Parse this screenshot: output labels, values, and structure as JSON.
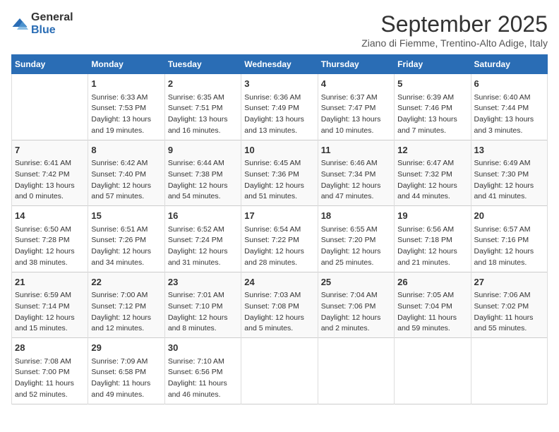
{
  "logo": {
    "general": "General",
    "blue": "Blue"
  },
  "title": "September 2025",
  "location": "Ziano di Fiemme, Trentino-Alto Adige, Italy",
  "days_of_week": [
    "Sunday",
    "Monday",
    "Tuesday",
    "Wednesday",
    "Thursday",
    "Friday",
    "Saturday"
  ],
  "weeks": [
    [
      {
        "day": "",
        "info": ""
      },
      {
        "day": "1",
        "info": "Sunrise: 6:33 AM\nSunset: 7:53 PM\nDaylight: 13 hours\nand 19 minutes."
      },
      {
        "day": "2",
        "info": "Sunrise: 6:35 AM\nSunset: 7:51 PM\nDaylight: 13 hours\nand 16 minutes."
      },
      {
        "day": "3",
        "info": "Sunrise: 6:36 AM\nSunset: 7:49 PM\nDaylight: 13 hours\nand 13 minutes."
      },
      {
        "day": "4",
        "info": "Sunrise: 6:37 AM\nSunset: 7:47 PM\nDaylight: 13 hours\nand 10 minutes."
      },
      {
        "day": "5",
        "info": "Sunrise: 6:39 AM\nSunset: 7:46 PM\nDaylight: 13 hours\nand 7 minutes."
      },
      {
        "day": "6",
        "info": "Sunrise: 6:40 AM\nSunset: 7:44 PM\nDaylight: 13 hours\nand 3 minutes."
      }
    ],
    [
      {
        "day": "7",
        "info": "Sunrise: 6:41 AM\nSunset: 7:42 PM\nDaylight: 13 hours\nand 0 minutes."
      },
      {
        "day": "8",
        "info": "Sunrise: 6:42 AM\nSunset: 7:40 PM\nDaylight: 12 hours\nand 57 minutes."
      },
      {
        "day": "9",
        "info": "Sunrise: 6:44 AM\nSunset: 7:38 PM\nDaylight: 12 hours\nand 54 minutes."
      },
      {
        "day": "10",
        "info": "Sunrise: 6:45 AM\nSunset: 7:36 PM\nDaylight: 12 hours\nand 51 minutes."
      },
      {
        "day": "11",
        "info": "Sunrise: 6:46 AM\nSunset: 7:34 PM\nDaylight: 12 hours\nand 47 minutes."
      },
      {
        "day": "12",
        "info": "Sunrise: 6:47 AM\nSunset: 7:32 PM\nDaylight: 12 hours\nand 44 minutes."
      },
      {
        "day": "13",
        "info": "Sunrise: 6:49 AM\nSunset: 7:30 PM\nDaylight: 12 hours\nand 41 minutes."
      }
    ],
    [
      {
        "day": "14",
        "info": "Sunrise: 6:50 AM\nSunset: 7:28 PM\nDaylight: 12 hours\nand 38 minutes."
      },
      {
        "day": "15",
        "info": "Sunrise: 6:51 AM\nSunset: 7:26 PM\nDaylight: 12 hours\nand 34 minutes."
      },
      {
        "day": "16",
        "info": "Sunrise: 6:52 AM\nSunset: 7:24 PM\nDaylight: 12 hours\nand 31 minutes."
      },
      {
        "day": "17",
        "info": "Sunrise: 6:54 AM\nSunset: 7:22 PM\nDaylight: 12 hours\nand 28 minutes."
      },
      {
        "day": "18",
        "info": "Sunrise: 6:55 AM\nSunset: 7:20 PM\nDaylight: 12 hours\nand 25 minutes."
      },
      {
        "day": "19",
        "info": "Sunrise: 6:56 AM\nSunset: 7:18 PM\nDaylight: 12 hours\nand 21 minutes."
      },
      {
        "day": "20",
        "info": "Sunrise: 6:57 AM\nSunset: 7:16 PM\nDaylight: 12 hours\nand 18 minutes."
      }
    ],
    [
      {
        "day": "21",
        "info": "Sunrise: 6:59 AM\nSunset: 7:14 PM\nDaylight: 12 hours\nand 15 minutes."
      },
      {
        "day": "22",
        "info": "Sunrise: 7:00 AM\nSunset: 7:12 PM\nDaylight: 12 hours\nand 12 minutes."
      },
      {
        "day": "23",
        "info": "Sunrise: 7:01 AM\nSunset: 7:10 PM\nDaylight: 12 hours\nand 8 minutes."
      },
      {
        "day": "24",
        "info": "Sunrise: 7:03 AM\nSunset: 7:08 PM\nDaylight: 12 hours\nand 5 minutes."
      },
      {
        "day": "25",
        "info": "Sunrise: 7:04 AM\nSunset: 7:06 PM\nDaylight: 12 hours\nand 2 minutes."
      },
      {
        "day": "26",
        "info": "Sunrise: 7:05 AM\nSunset: 7:04 PM\nDaylight: 11 hours\nand 59 minutes."
      },
      {
        "day": "27",
        "info": "Sunrise: 7:06 AM\nSunset: 7:02 PM\nDaylight: 11 hours\nand 55 minutes."
      }
    ],
    [
      {
        "day": "28",
        "info": "Sunrise: 7:08 AM\nSunset: 7:00 PM\nDaylight: 11 hours\nand 52 minutes."
      },
      {
        "day": "29",
        "info": "Sunrise: 7:09 AM\nSunset: 6:58 PM\nDaylight: 11 hours\nand 49 minutes."
      },
      {
        "day": "30",
        "info": "Sunrise: 7:10 AM\nSunset: 6:56 PM\nDaylight: 11 hours\nand 46 minutes."
      },
      {
        "day": "",
        "info": ""
      },
      {
        "day": "",
        "info": ""
      },
      {
        "day": "",
        "info": ""
      },
      {
        "day": "",
        "info": ""
      }
    ]
  ]
}
